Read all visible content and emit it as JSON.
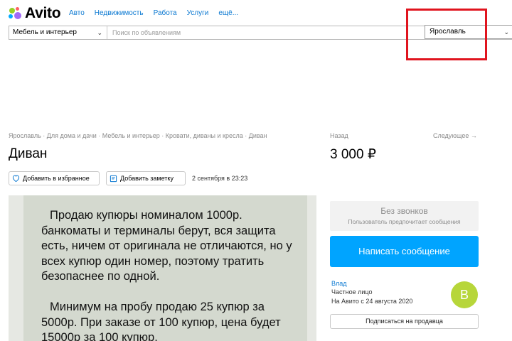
{
  "header": {
    "logo_text": "Avito",
    "nav": [
      "Авто",
      "Недвижимость",
      "Работа",
      "Услуги",
      "ещё..."
    ]
  },
  "search": {
    "category": "Мебель и интерьер",
    "placeholder": "Поиск по объявлениям",
    "value": "",
    "city": "Ярославль"
  },
  "listing": {
    "breadcrumb": "Ярославль · Для дома и дачи · Мебель и интерьер · Кровати, диваны и кресла · Диван",
    "title": "Диван",
    "price": "3 000 ₽",
    "back_label": "Назад",
    "next_label": "Следующее →",
    "favorite_label": "Добавить в избранное",
    "note_label": "Добавить заметку",
    "date": "2 сентября в 23:23",
    "photo_text": [
      "Продаю купюры номиналом 1000р.",
      "банкоматы и терминалы берут, вся защита",
      "есть, ничем от оригинала не отличаются, но у",
      "всех купюр один номер, поэтому тратить",
      "безопаснее по одной.",
      "",
      "Минимум на пробу продаю 25 купюр за",
      "5000р. При заказе от 100 купюр, цена будет",
      "15000р за 100 купюр."
    ]
  },
  "contact": {
    "no_calls_title": "Без звонков",
    "no_calls_sub": "Пользователь предпочитает сообщения",
    "message_button": "Написать сообщение"
  },
  "seller": {
    "name": "Влад",
    "type": "Частное лицо",
    "since": "На Авито с 24 августа 2020",
    "avatar_letter": "В",
    "subscribe_label": "Подписаться на продавца"
  },
  "colors": {
    "link_blue": "#0a78d1",
    "primary_button": "#00a4ff",
    "highlight_red": "#e0141e",
    "avatar_green": "#b7d63a"
  }
}
